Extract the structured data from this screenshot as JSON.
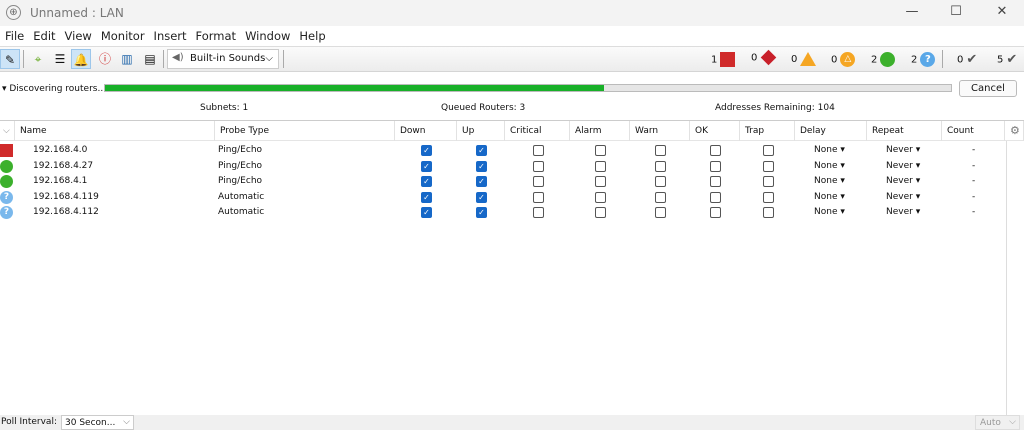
{
  "window": {
    "title": "Unnamed : LAN",
    "minimize": "—",
    "maximize": "☐",
    "close": "✕"
  },
  "menu": [
    "File",
    "Edit",
    "View",
    "Monitor",
    "Insert",
    "Format",
    "Window",
    "Help"
  ],
  "toolbar": {
    "sound_select": "Built-in Sounds"
  },
  "status_counts": [
    {
      "name": "down",
      "count": "1",
      "color": "#d02a2a"
    },
    {
      "name": "critical",
      "count": "0",
      "color": "#c8202a"
    },
    {
      "name": "alarm",
      "count": "0",
      "color": "#f5a623"
    },
    {
      "name": "warn",
      "count": "0",
      "color": "#f5a623"
    },
    {
      "name": "up",
      "count": "2",
      "color": "#3cb02c"
    },
    {
      "name": "unknown",
      "count": "2",
      "color": "#5aa8e8"
    },
    {
      "name": "acknowledged",
      "count": "0",
      "color": "#555555"
    },
    {
      "name": "unacknowledged",
      "count": "5",
      "color": "#555555"
    }
  ],
  "discovery": {
    "label": "▾ Discovering routers...",
    "progress": 0.59,
    "cancel": "Cancel",
    "subnets": "Subnets: 1",
    "queued": "Queued Routers: 3",
    "remaining": "Addresses Remaining: 104"
  },
  "table": {
    "columns": [
      "Name",
      "Probe Type",
      "Down",
      "Up",
      "Critical",
      "Alarm",
      "Warn",
      "OK",
      "Trap",
      "Delay",
      "Repeat",
      "Count"
    ],
    "rows": [
      {
        "status": "down",
        "name": "192.168.4.0",
        "probe": "Ping/Echo",
        "down": true,
        "up": true,
        "critical": false,
        "alarm": false,
        "warn": false,
        "ok": false,
        "trap": false,
        "delay": "None",
        "repeat": "Never",
        "count": "-"
      },
      {
        "status": "up",
        "name": "192.168.4.27",
        "probe": "Ping/Echo",
        "down": true,
        "up": true,
        "critical": false,
        "alarm": false,
        "warn": false,
        "ok": false,
        "trap": false,
        "delay": "None",
        "repeat": "Never",
        "count": "-"
      },
      {
        "status": "up",
        "name": "192.168.4.1",
        "probe": "Ping/Echo",
        "down": true,
        "up": true,
        "critical": false,
        "alarm": false,
        "warn": false,
        "ok": false,
        "trap": false,
        "delay": "None",
        "repeat": "Never",
        "count": "-"
      },
      {
        "status": "unknown",
        "name": "192.168.4.119",
        "probe": "Automatic",
        "down": true,
        "up": true,
        "critical": false,
        "alarm": false,
        "warn": false,
        "ok": false,
        "trap": false,
        "delay": "None",
        "repeat": "Never",
        "count": "-"
      },
      {
        "status": "unknown",
        "name": "192.168.4.112",
        "probe": "Automatic",
        "down": true,
        "up": true,
        "critical": false,
        "alarm": false,
        "warn": false,
        "ok": false,
        "trap": false,
        "delay": "None",
        "repeat": "Never",
        "count": "-"
      }
    ]
  },
  "footer": {
    "poll_label": "Poll Interval:",
    "poll_value": "30 Secon...",
    "zoom": "Auto"
  }
}
